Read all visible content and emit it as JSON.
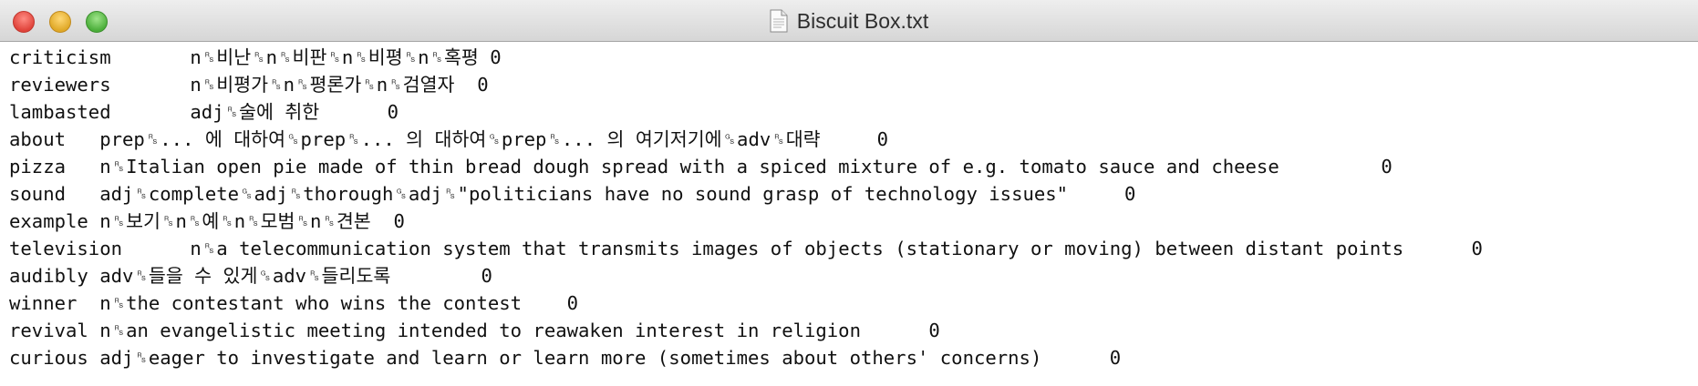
{
  "window": {
    "title": "Biscuit Box.txt",
    "icon": "text-document-icon"
  },
  "lines": [
    {
      "word": "criticism",
      "gap": "       ",
      "def": "n␞비난␞n␞비판␞n␞비평␞n␞혹평",
      "tail": " 0"
    },
    {
      "word": "reviewers",
      "gap": "       ",
      "def": "n␞비평가␞n␞평론가␞n␞검열자",
      "tail": "  0"
    },
    {
      "word": "lambasted",
      "gap": "       ",
      "def": "adj␞술에 취한",
      "tail": "      0"
    },
    {
      "word": "about",
      "gap": "   ",
      "def": "prep␞... 에 대하여␝prep␞... 의 대하여␝prep␞... 의 여기저기에␝adv␞대략",
      "tail": "     0"
    },
    {
      "word": "pizza",
      "gap": "   ",
      "def": "n␞Italian open pie made of thin bread dough spread with a spiced mixture of e.g. tomato sauce and cheese",
      "tail": "         0"
    },
    {
      "word": "sound",
      "gap": "   ",
      "def": "adj␞complete␝adj␞thorough␝adj␞\"politicians have no sound grasp of technology issues\"",
      "tail": "     0"
    },
    {
      "word": "example",
      "gap": " ",
      "def": "n␞보기␞n␞예␞n␞모범␞n␞견본",
      "tail": "  0"
    },
    {
      "word": "television",
      "gap": "      ",
      "def": "n␞a telecommunication system that transmits images of objects (stationary or moving) between distant points",
      "tail": "      0"
    },
    {
      "word": "audibly",
      "gap": " ",
      "def": "adv␞들을 수 있게␝adv␞들리도록",
      "tail": "        0"
    },
    {
      "word": "winner",
      "gap": "  ",
      "def": "n␞the contestant who wins the contest",
      "tail": "    0"
    },
    {
      "word": "revival",
      "gap": " ",
      "def": "n␞an evangelistic meeting intended to reawaken interest in religion",
      "tail": "      0"
    },
    {
      "word": "curious",
      "gap": " ",
      "def": "adj␞eager to investigate and learn or learn more (sometimes about others' concerns)",
      "tail": "      0"
    }
  ]
}
